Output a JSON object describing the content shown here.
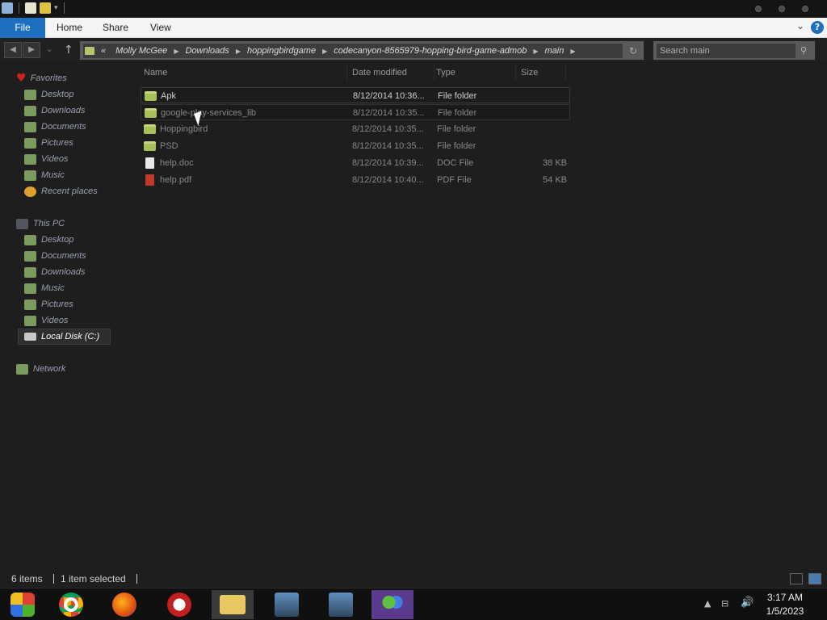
{
  "ribbon": {
    "tabs": [
      "File",
      "Home",
      "Share",
      "View"
    ],
    "help_glyph": "?",
    "expand_glyph": "⌄"
  },
  "address": {
    "overflow": "«",
    "crumbs": [
      "Molly McGee",
      "Downloads",
      "hoppingbirdgame",
      "codecanyon-8565979-hopping-bird-game-admob",
      "main"
    ]
  },
  "search": {
    "placeholder": "Search main"
  },
  "navpane": {
    "favorites_label": "Favorites",
    "favorites": [
      "Desktop",
      "Downloads",
      "Documents",
      "Pictures",
      "Videos",
      "Music",
      "Recent places"
    ],
    "thispc_label": "This PC",
    "thispc": [
      "Desktop",
      "Documents",
      "Downloads",
      "Music",
      "Pictures",
      "Videos",
      "Local Disk (C:)"
    ],
    "network_label": "Network"
  },
  "columns": {
    "name": "Name",
    "date": "Date modified",
    "type": "Type",
    "size": "Size"
  },
  "files": [
    {
      "name": "Apk",
      "date": "8/12/2014 10:36...",
      "type": "File folder",
      "size": "",
      "icon": "folder-icon"
    },
    {
      "name": "google-play-services_lib",
      "date": "8/12/2014 10:35...",
      "type": "File folder",
      "size": "",
      "icon": "folder-icon"
    },
    {
      "name": "Hoppingbird",
      "date": "8/12/2014 10:35...",
      "type": "File folder",
      "size": "",
      "icon": "folder-icon"
    },
    {
      "name": "PSD",
      "date": "8/12/2014 10:35...",
      "type": "File folder",
      "size": "",
      "icon": "folder-icon"
    },
    {
      "name": "help.doc",
      "date": "8/12/2014 10:39...",
      "type": "DOC File",
      "size": "38 KB",
      "icon": "doc-file-icon"
    },
    {
      "name": "help.pdf",
      "date": "8/12/2014 10:40...",
      "type": "PDF File",
      "size": "54 KB",
      "icon": "pdf-file-icon"
    }
  ],
  "status": {
    "count": "6 items",
    "selection": "1 item selected"
  },
  "clock": {
    "time": "3:17 AM",
    "date": "1/5/2023"
  },
  "taskbar_apps": [
    "start-orb-icon",
    "chrome-icon",
    "firefox-icon",
    "opera-icon",
    "file-explorer-icon",
    "network-setup-icon",
    "network-setup-icon",
    "people-icon"
  ]
}
